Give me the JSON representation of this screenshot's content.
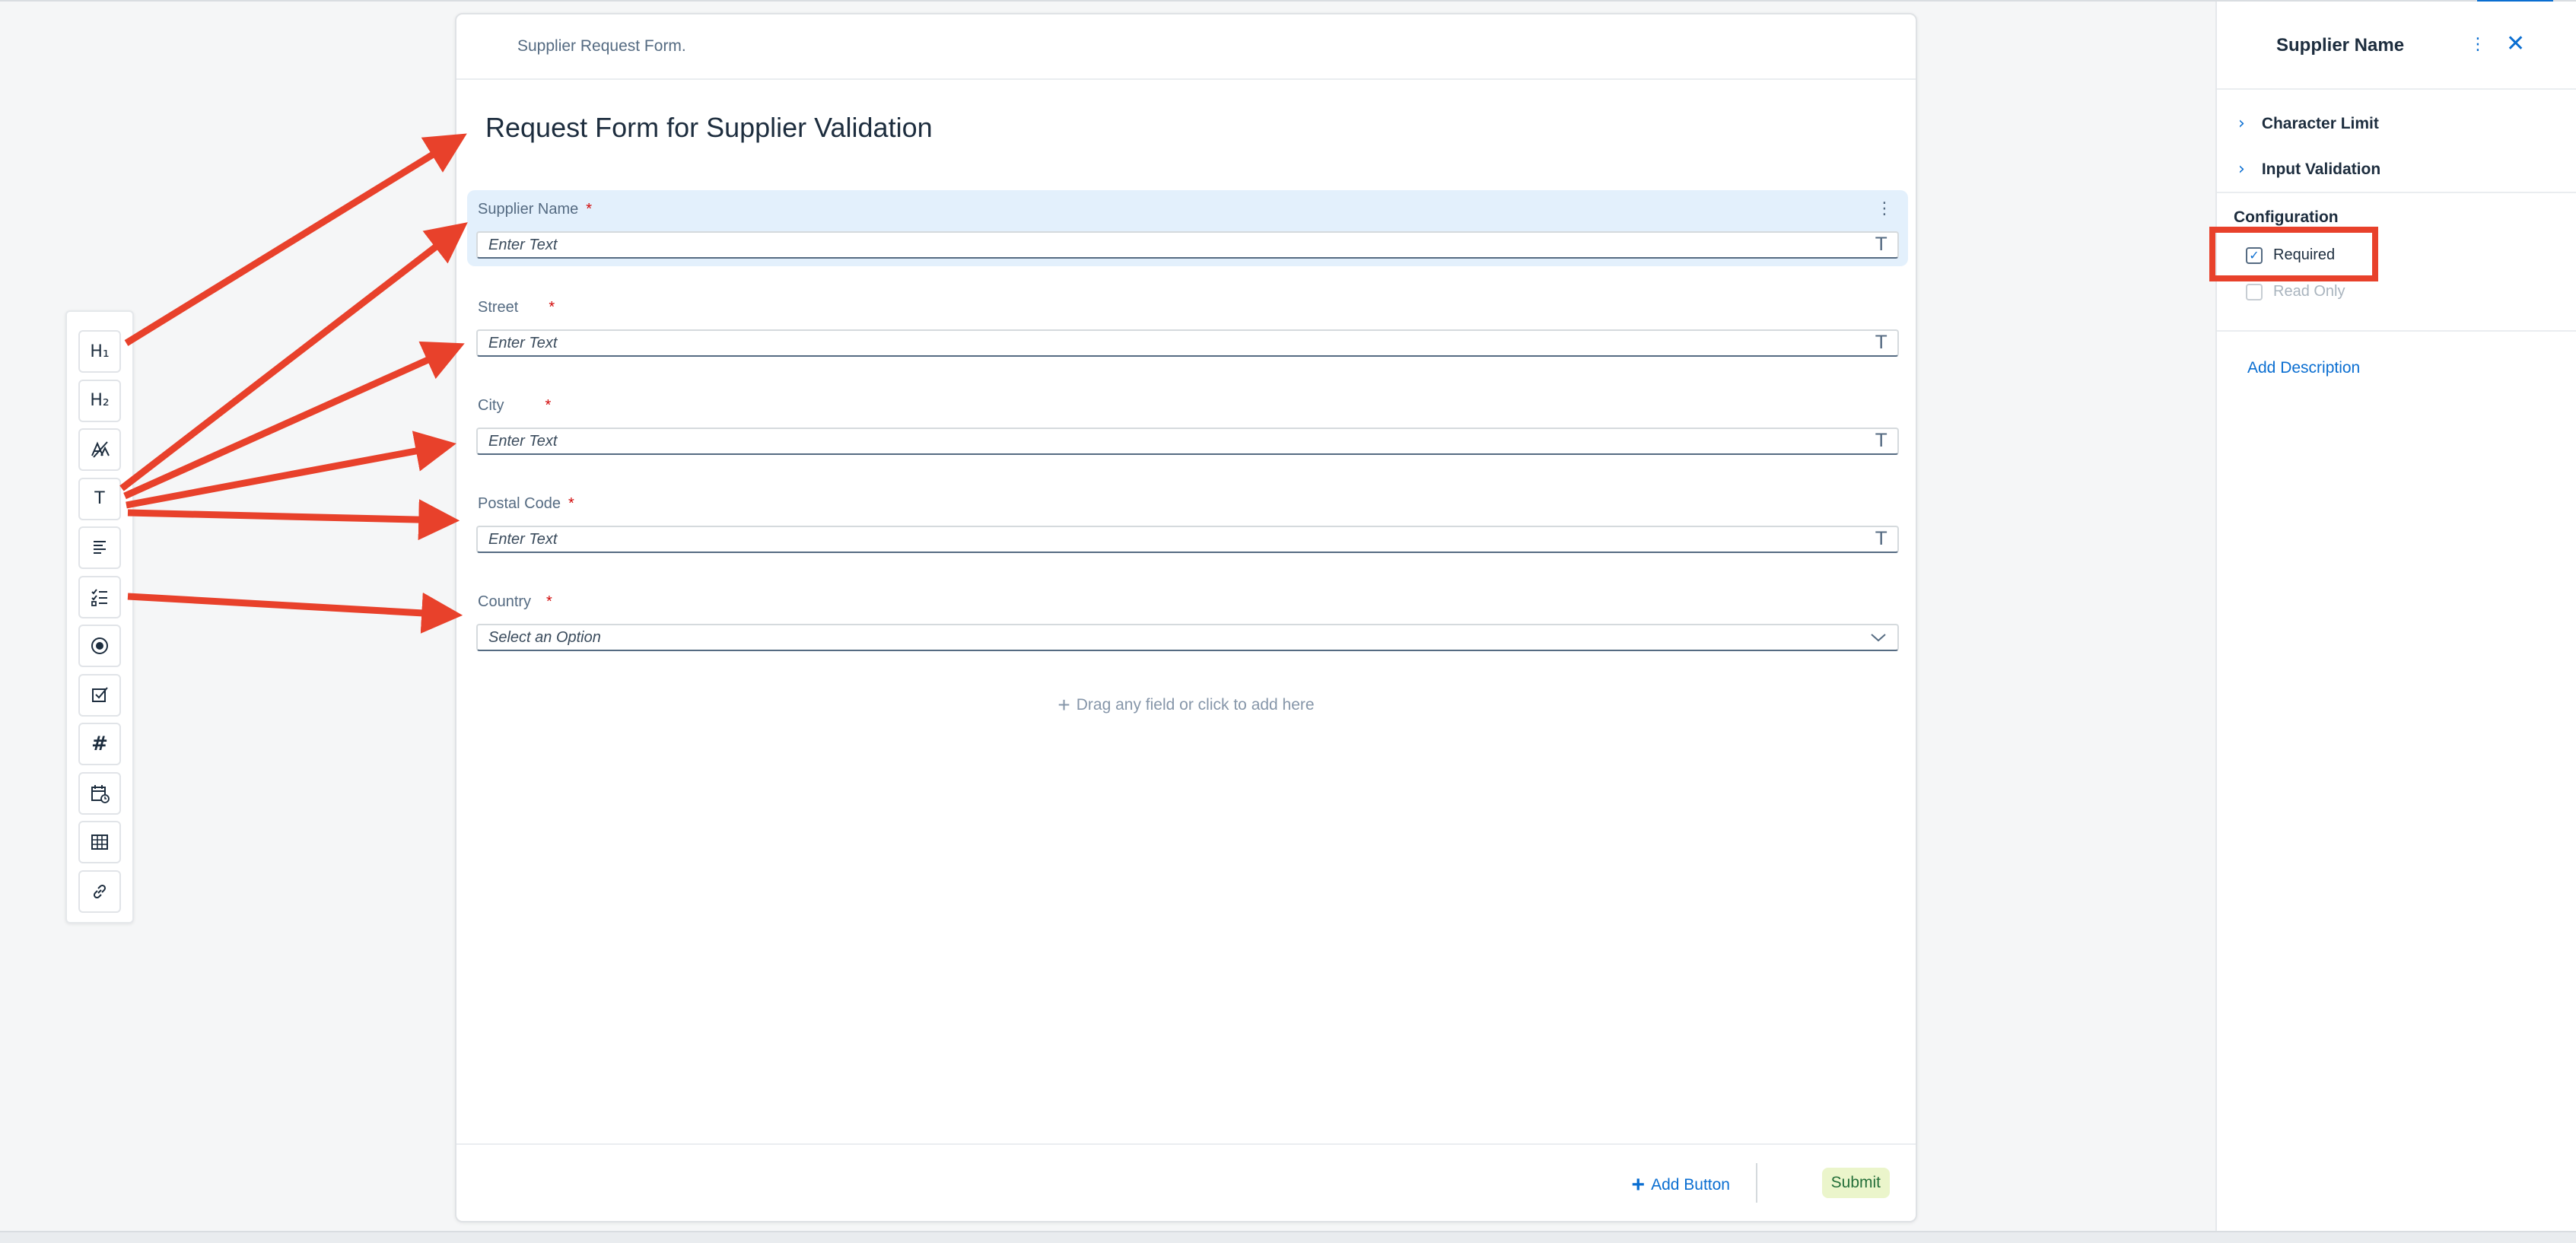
{
  "toolbox": {
    "tools": [
      {
        "icon": "heading-1-icon",
        "glyph": "H₁"
      },
      {
        "icon": "heading-2-icon",
        "glyph": "H₂"
      },
      {
        "icon": "text-style-icon",
        "glyph": ""
      },
      {
        "icon": "text-field-icon",
        "glyph": "T"
      },
      {
        "icon": "paragraph-icon",
        "glyph": ""
      },
      {
        "icon": "checklist-icon",
        "glyph": ""
      },
      {
        "icon": "radio-button-icon",
        "glyph": ""
      },
      {
        "icon": "checkbox-icon",
        "glyph": ""
      },
      {
        "icon": "number-icon",
        "glyph": "#"
      },
      {
        "icon": "date-icon",
        "glyph": ""
      },
      {
        "icon": "table-icon",
        "glyph": ""
      },
      {
        "icon": "link-icon",
        "glyph": ""
      }
    ]
  },
  "form": {
    "header": "Supplier Request Form.",
    "title": "Request Form for Supplier Validation",
    "fields": [
      {
        "label": "Supplier Name",
        "required_mark": "*",
        "placeholder": "Enter Text",
        "selected": true
      },
      {
        "label": "Street",
        "required_mark": "*",
        "placeholder": "Enter Text"
      },
      {
        "label": "City",
        "required_mark": "*",
        "placeholder": "Enter Text"
      },
      {
        "label": "Postal Code",
        "required_mark": "*",
        "placeholder": "Enter Text"
      },
      {
        "label": "Country",
        "required_mark": "*",
        "placeholder": "Select an Option"
      }
    ],
    "drop_hint": "Drag any field or click to add here",
    "add_button_label": "Add Button",
    "submit_label": "Submit"
  },
  "properties": {
    "title": "Supplier Name",
    "sections": [
      "Character Limit",
      "Input Validation"
    ],
    "configuration_title": "Configuration",
    "required_label": "Required",
    "required_checked": true,
    "read_only_label": "Read Only",
    "read_only_checked": false,
    "add_description": "Add Description"
  },
  "colors": {
    "accent": "#0a6ed1",
    "annotation": "#e8412b",
    "selected_field_bg": "#e3f0fc",
    "submit_bg": "#ebf5cb"
  }
}
